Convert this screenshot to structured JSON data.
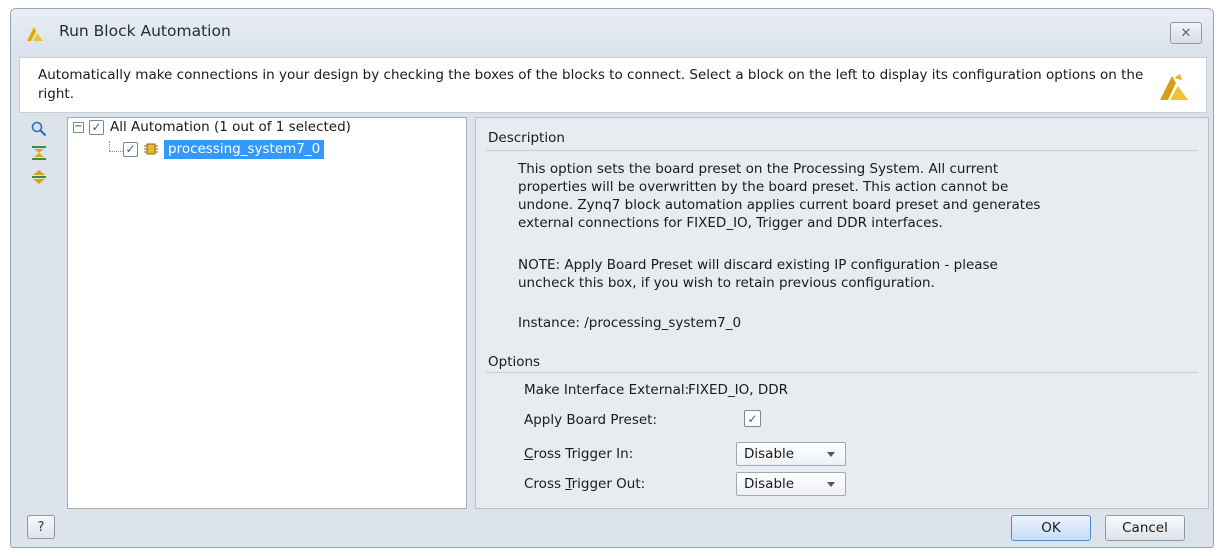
{
  "window": {
    "title": "Run Block Automation",
    "close_glyph": "✕"
  },
  "banner": {
    "text": "Automatically make connections in your design by checking the boxes of the blocks to connect. Select a block on the left to display its configuration options on the right."
  },
  "toolbar": {
    "icons": [
      "search-icon",
      "collapse-all-icon",
      "expand-all-icon"
    ]
  },
  "tree": {
    "root": {
      "label": "All Automation (1 out of 1 selected)",
      "checked": true,
      "expander": "−"
    },
    "child": {
      "label": "processing_system7_0",
      "checked": true,
      "icon": "ip-block-icon"
    }
  },
  "description": {
    "header": "Description",
    "paragraph1": [
      "This option sets the board preset on the Processing System. All current",
      "properties will be overwritten by the board preset. This action cannot be",
      "undone. Zynq7 block automation applies current board preset and generates",
      "external connections for FIXED_IO, Trigger and DDR interfaces."
    ],
    "note": [
      "NOTE: Apply Board Preset will discard existing IP configuration - please",
      "uncheck this box, if you wish to retain previous configuration."
    ],
    "instance": "Instance: /processing_system7_0"
  },
  "options": {
    "header": "Options",
    "make_external_label": "Make Interface External:",
    "make_external_value": "FIXED_IO, DDR",
    "apply_preset_label": "Apply Board Preset:",
    "apply_preset_checked": true,
    "cross_trigger_in_label_first": "C",
    "cross_trigger_in_label_rest": "ross Trigger In:",
    "cross_trigger_in_value": "Disable",
    "cross_trigger_out_label_pre": "Cross ",
    "cross_trigger_out_label_ul": "T",
    "cross_trigger_out_label_rest": "rigger Out:",
    "cross_trigger_out_value": "Disable"
  },
  "footer": {
    "help": "?",
    "ok": "OK",
    "cancel": "Cancel"
  },
  "colors": {
    "selection": "#3399ff",
    "check": "#2d5fa8",
    "xilinx_logo": "#d4a017"
  }
}
